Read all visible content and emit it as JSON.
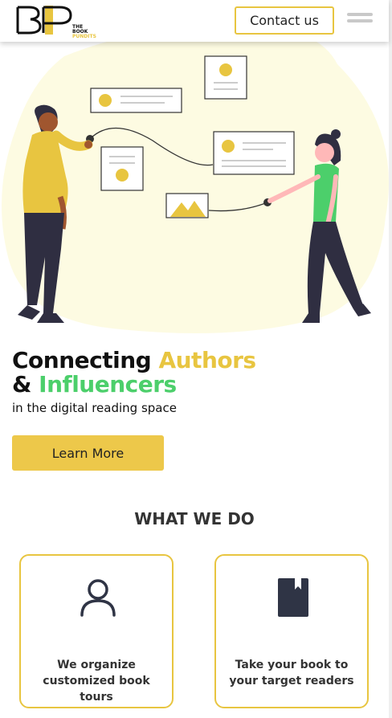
{
  "header": {
    "logo_text_line1": "THE BOOK",
    "logo_text_line2": "PUNDITS",
    "contact_label": "Contact us"
  },
  "hero": {
    "headline_part1": "Connecting ",
    "headline_part2": "Authors",
    "headline_part3": "& ",
    "headline_part4": "Influencers",
    "subline": "in the digital reading space",
    "cta_label": "Learn More"
  },
  "services": {
    "title": "WHAT WE DO",
    "cards": [
      {
        "text": "We organize customized book tours",
        "icon": "user-icon"
      },
      {
        "text": "Take your book to your target readers",
        "icon": "book-icon"
      }
    ]
  },
  "colors": {
    "accent_yellow": "#e8c540",
    "accent_green": "#4ccf6b",
    "blob": "#fdfbe2"
  }
}
